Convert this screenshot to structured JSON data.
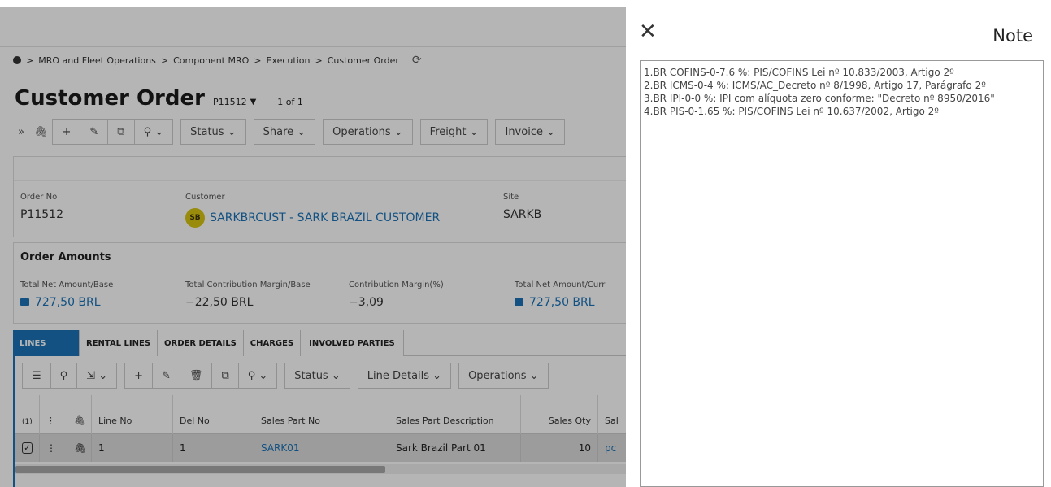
{
  "breadcrumb": {
    "items": [
      "MRO and Fleet Operations",
      "Component MRO",
      "Execution",
      "Customer Order"
    ],
    "separator": ">"
  },
  "page": {
    "title": "Customer Order",
    "order_selector": "P11512",
    "pager": "1 of 1"
  },
  "toolbar": {
    "status": "Status",
    "share": "Share",
    "operations": "Operations",
    "freight": "Freight",
    "invoice": "Invoice"
  },
  "header": {
    "order_no_label": "Order No",
    "order_no": "P11512",
    "customer_label": "Customer",
    "customer_initials": "SB",
    "customer": "SARKBRCUST - SARK BRAZIL CUSTOMER",
    "site_label": "Site",
    "site": "SARKB"
  },
  "amounts": {
    "title": "Order Amounts",
    "net_base_label": "Total Net Amount/Base",
    "net_base": "727,50 BRL",
    "contrib_base_label": "Total Contribution Margin/Base",
    "contrib_base": "−22,50 BRL",
    "contrib_pct_label": "Contribution Margin(%)",
    "contrib_pct": "−3,09",
    "net_curr_label": "Total Net Amount/Curr",
    "net_curr": "727,50 BRL"
  },
  "tabs": [
    "LINES",
    "RENTAL LINES",
    "ORDER DETAILS",
    "CHARGES",
    "INVOLVED PARTIES"
  ],
  "grid_toolbar": {
    "status": "Status",
    "line_details": "Line Details",
    "operations": "Operations"
  },
  "grid": {
    "selected_count": "(1)",
    "columns": [
      "Line No",
      "Del No",
      "Sales Part No",
      "Sales Part Description",
      "Sales Qty",
      "Sal"
    ],
    "rows": [
      {
        "line_no": "1",
        "del_no": "1",
        "sales_part_no": "SARK01",
        "description": "Sark Brazil Part 01",
        "qty": "10",
        "extra": "pc"
      }
    ]
  },
  "note": {
    "title": "Note",
    "text": "1.BR COFINS-0-7.6 %: PIS/COFINS Lei nº 10.833/2003, Artigo 2º\n2.BR ICMS-0-4 %: ICMS/AC_Decreto nº 8/1998, Artigo 17, Parágrafo 2º\n3.BR IPI-0-0 %: IPI com alíquota zero conforme: \"Decreto nº 8950/2016\"\n4.BR PIS-0-1.65 %: PIS/COFINS Lei nº 10.637/2002, Artigo 2º"
  },
  "colors": {
    "accent": "#1a73b8",
    "avatar": "#d8c411",
    "overlay": "rgba(0,0,0,0.29)"
  }
}
